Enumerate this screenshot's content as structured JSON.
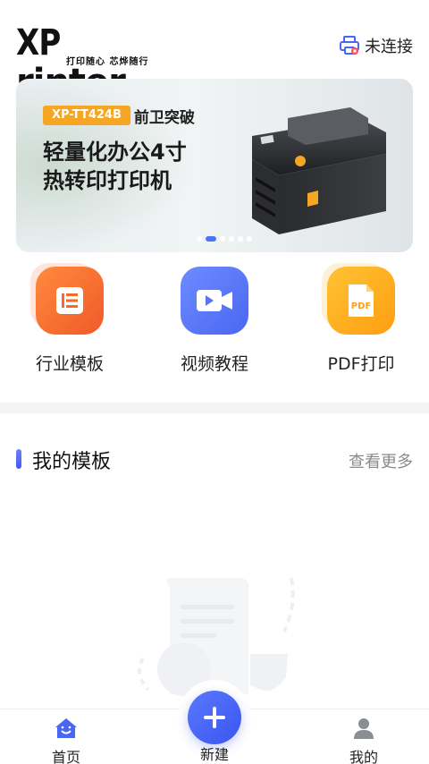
{
  "header": {
    "logo_main": "XPrinter",
    "logo_xp": "XP",
    "logo_rest": "rinter",
    "logo_tagline": "打印随心 芯烨随行",
    "connection_label": "未连接",
    "connection_icon": "printer-disconnected-icon"
  },
  "banner": {
    "model": "XP-TT424B",
    "tag": "前卫突破",
    "line1": "轻量化办公4寸",
    "line2": "热转印打印机",
    "slide_count": 6,
    "active_slide": 2
  },
  "quick_actions": [
    {
      "label": "行业模板",
      "icon": "template-doc-icon",
      "color": "#f26a2e"
    },
    {
      "label": "视频教程",
      "icon": "video-camera-icon",
      "color": "#5b73f6"
    },
    {
      "label": "PDF打印",
      "icon": "pdf-file-icon",
      "color": "#ffae1a",
      "icon_text": "PDF"
    }
  ],
  "my_templates": {
    "title": "我的模板",
    "more_label": "查看更多"
  },
  "bottom_nav": {
    "home": "首页",
    "new": "新建",
    "mine": "我的"
  },
  "colors": {
    "accent": "#3d5cf2",
    "orange": "#f26a2e",
    "yellow": "#ffae1a"
  }
}
